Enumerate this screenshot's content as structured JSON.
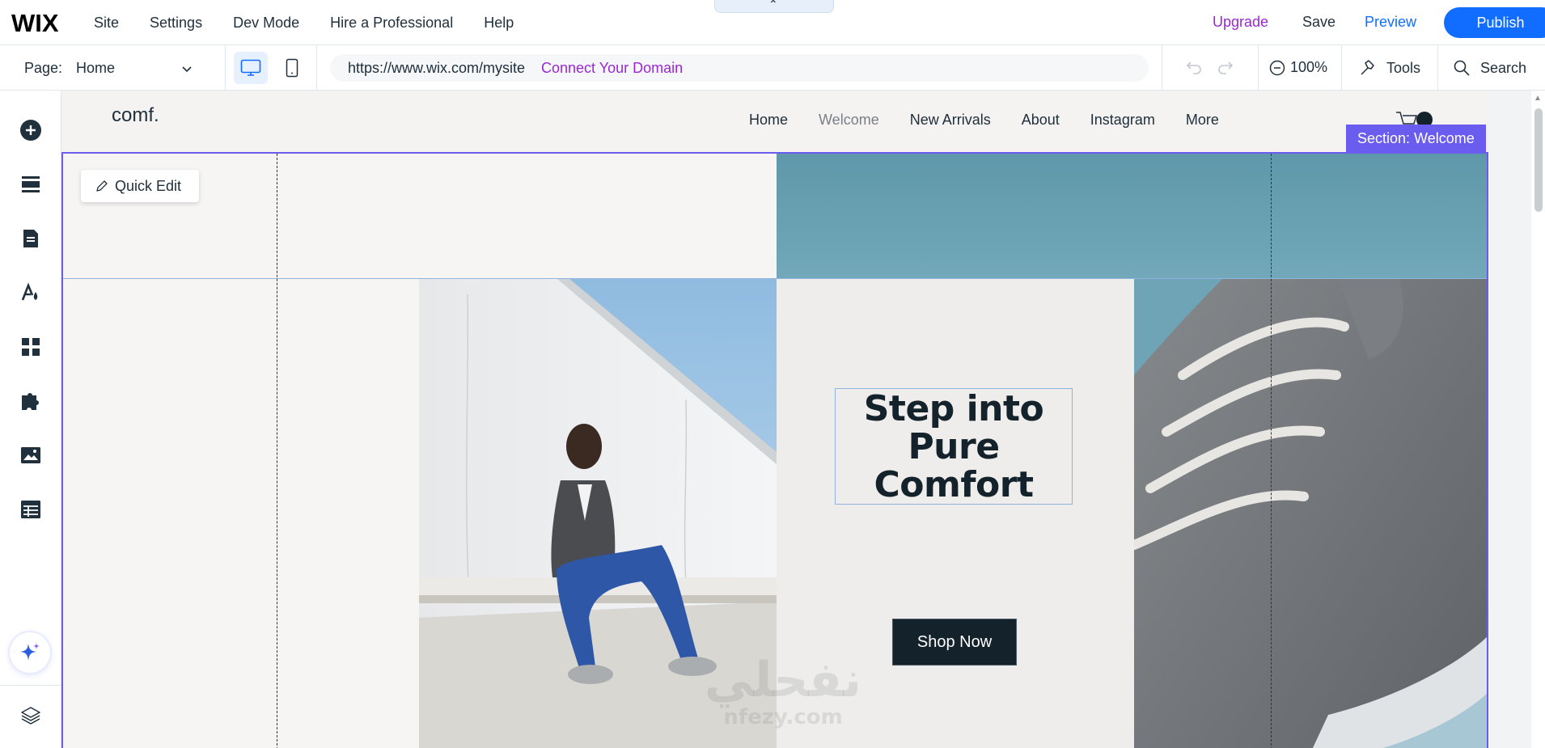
{
  "topbar": {
    "logo": "WIX",
    "menu": [
      "Site",
      "Settings",
      "Dev Mode",
      "Hire a Professional",
      "Help"
    ],
    "upgrade": "Upgrade",
    "save": "Save",
    "preview": "Preview",
    "publish": "Publish",
    "colors": {
      "publish": "#116dff",
      "upgrade": "#9a27d5"
    }
  },
  "toolbar": {
    "page_label": "Page:",
    "page_value": "Home",
    "url": "https://www.wix.com/mysite",
    "connect_domain": "Connect Your Domain",
    "zoom": "100%",
    "tools": "Tools",
    "search": "Search"
  },
  "sidebar": {
    "items": [
      "add-icon",
      "sections-icon",
      "pages-icon",
      "design-icon",
      "apps-icon",
      "business-icon",
      "media-icon",
      "cms-icon"
    ],
    "ai_button": "sparkle-icon",
    "layers": "layers-icon"
  },
  "site": {
    "brand": "comf.",
    "nav": [
      "Home",
      "Welcome",
      "New Arrivals",
      "About",
      "Instagram",
      "More"
    ],
    "section_label": "Section: Welcome",
    "quick_edit": "Quick Edit",
    "headline": "Step into Pure Comfort",
    "cta": "Shop Now",
    "colors": {
      "section_outline": "#6b5cf0",
      "cta_bg": "#13222b"
    }
  },
  "watermark": {
    "arabic": "نفحلي",
    "latin": "nfezy.com"
  }
}
